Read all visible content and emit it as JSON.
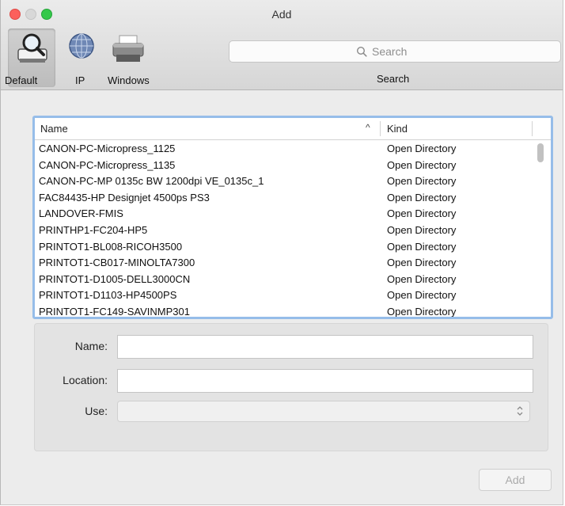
{
  "window": {
    "title": "Add"
  },
  "toolbar": {
    "items": [
      {
        "label": "Default",
        "icon": "magnifier-printer-icon",
        "selected": true
      },
      {
        "label": "IP",
        "icon": "globe-icon",
        "selected": false
      },
      {
        "label": "Windows",
        "icon": "printer-icon",
        "selected": false
      }
    ],
    "search": {
      "placeholder": "Search",
      "label": "Search",
      "icon": "search-icon"
    }
  },
  "printer_list": {
    "columns": {
      "name": "Name",
      "kind": "Kind",
      "sort_indicator": "^"
    },
    "rows": [
      {
        "name": "CANON-PC-Micropress_1125",
        "kind": "Open Directory"
      },
      {
        "name": "CANON-PC-Micropress_1135",
        "kind": "Open Directory"
      },
      {
        "name": "CANON-PC-MP 0135c BW 1200dpi VE_0135c_1",
        "kind": "Open Directory"
      },
      {
        "name": "FAC84435-HP Designjet 4500ps PS3",
        "kind": "Open Directory"
      },
      {
        "name": "LANDOVER-FMIS",
        "kind": "Open Directory"
      },
      {
        "name": "PRINTHP1-FC204-HP5",
        "kind": "Open Directory"
      },
      {
        "name": "PRINTOT1-BL008-RICOH3500",
        "kind": "Open Directory"
      },
      {
        "name": "PRINTOT1-CB017-MINOLTA7300",
        "kind": "Open Directory"
      },
      {
        "name": "PRINTOT1-D1005-DELL3000CN",
        "kind": "Open Directory"
      },
      {
        "name": "PRINTOT1-D1103-HP4500PS",
        "kind": "Open Directory"
      },
      {
        "name": "PRINTOT1-FC149-SAVINMP301",
        "kind": "Open Directory"
      }
    ]
  },
  "form": {
    "name": {
      "label": "Name:",
      "value": ""
    },
    "location": {
      "label": "Location:",
      "value": ""
    },
    "use": {
      "label": "Use:",
      "value": ""
    }
  },
  "buttons": {
    "add": "Add"
  },
  "colors": {
    "focus_ring": "#96bde9",
    "close": "#fc605c",
    "zoom": "#34c84a"
  }
}
